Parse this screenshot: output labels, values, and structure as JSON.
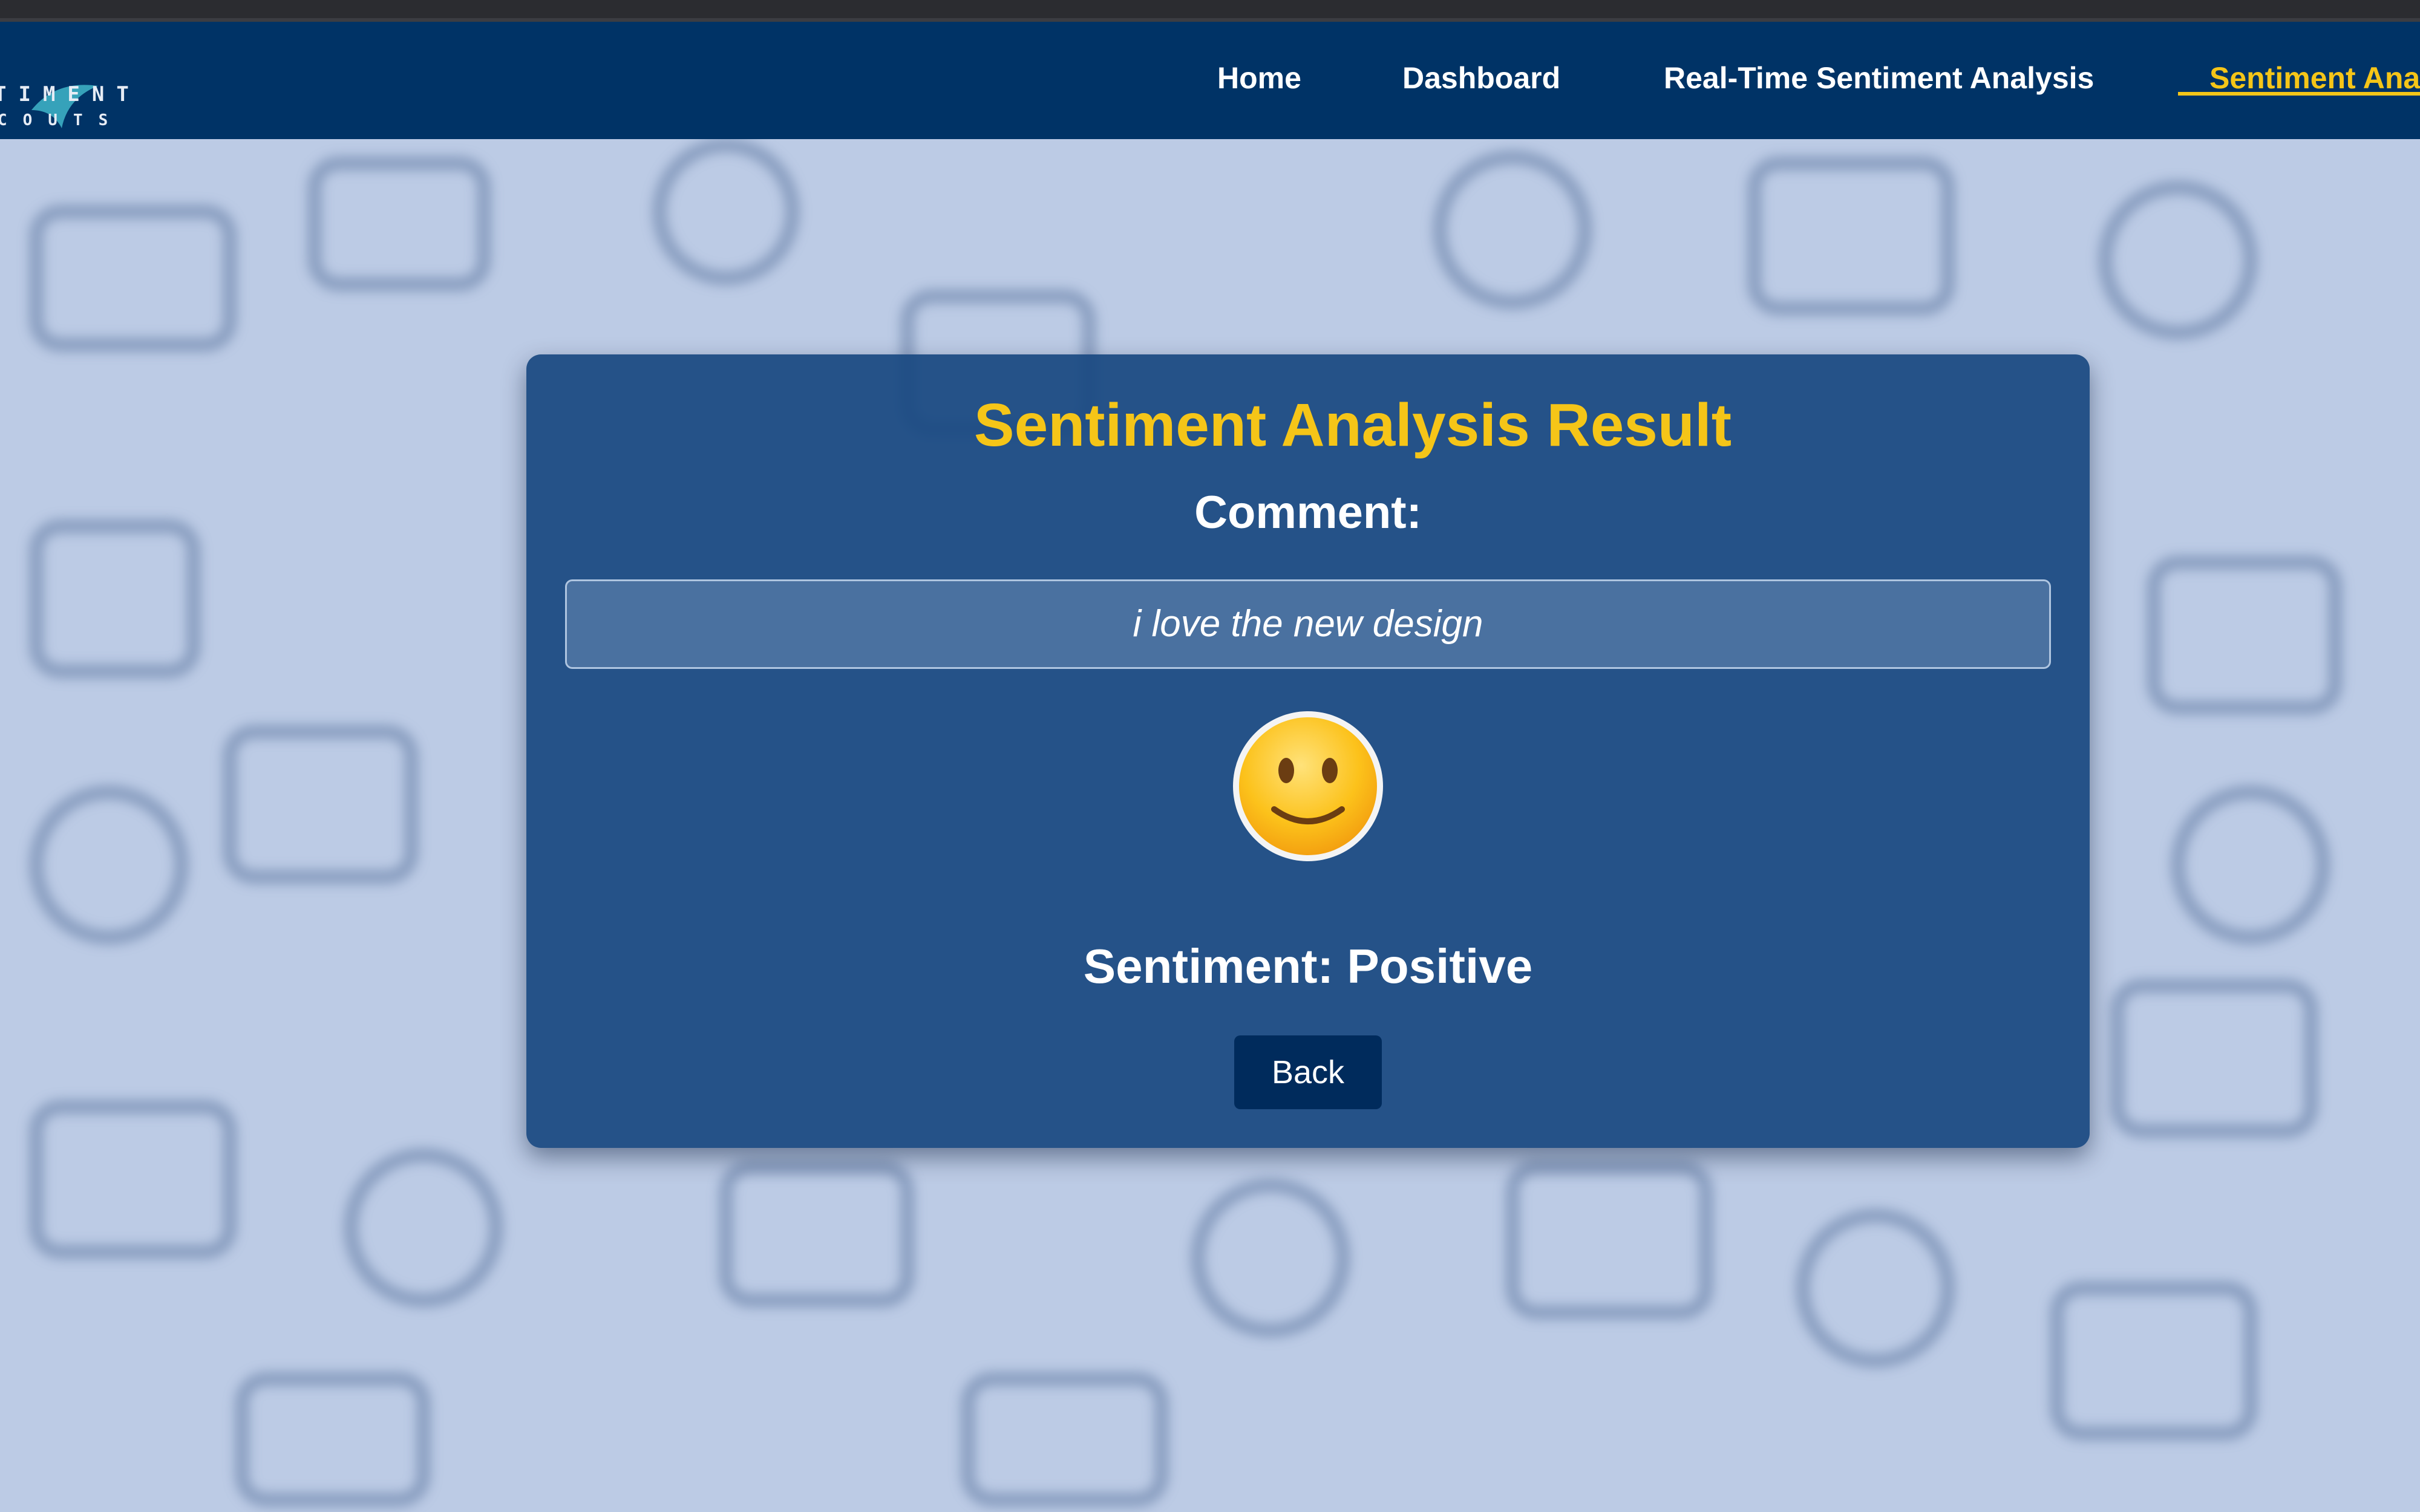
{
  "navbar": {
    "logo_line1": "TIMENT",
    "logo_line2": "COUTS",
    "items": [
      {
        "label": "Home",
        "active": false
      },
      {
        "label": "Dashboard",
        "active": false
      },
      {
        "label": "Real-Time Sentiment Analysis",
        "active": false
      },
      {
        "label": "Sentiment Ana",
        "active": true
      }
    ]
  },
  "result": {
    "title": "Sentiment Analysis Result",
    "comment_label": "Comment:",
    "comment_text": "i love the new design",
    "sentiment_text": "Sentiment: Positive",
    "back_label": "Back",
    "emoji_icon": "slightly-smiling-face-icon"
  },
  "colors": {
    "navbar_bg": "#003366",
    "accent": "#f5c518",
    "card_bg": "#184880",
    "page_bg": "#bccbe5"
  }
}
